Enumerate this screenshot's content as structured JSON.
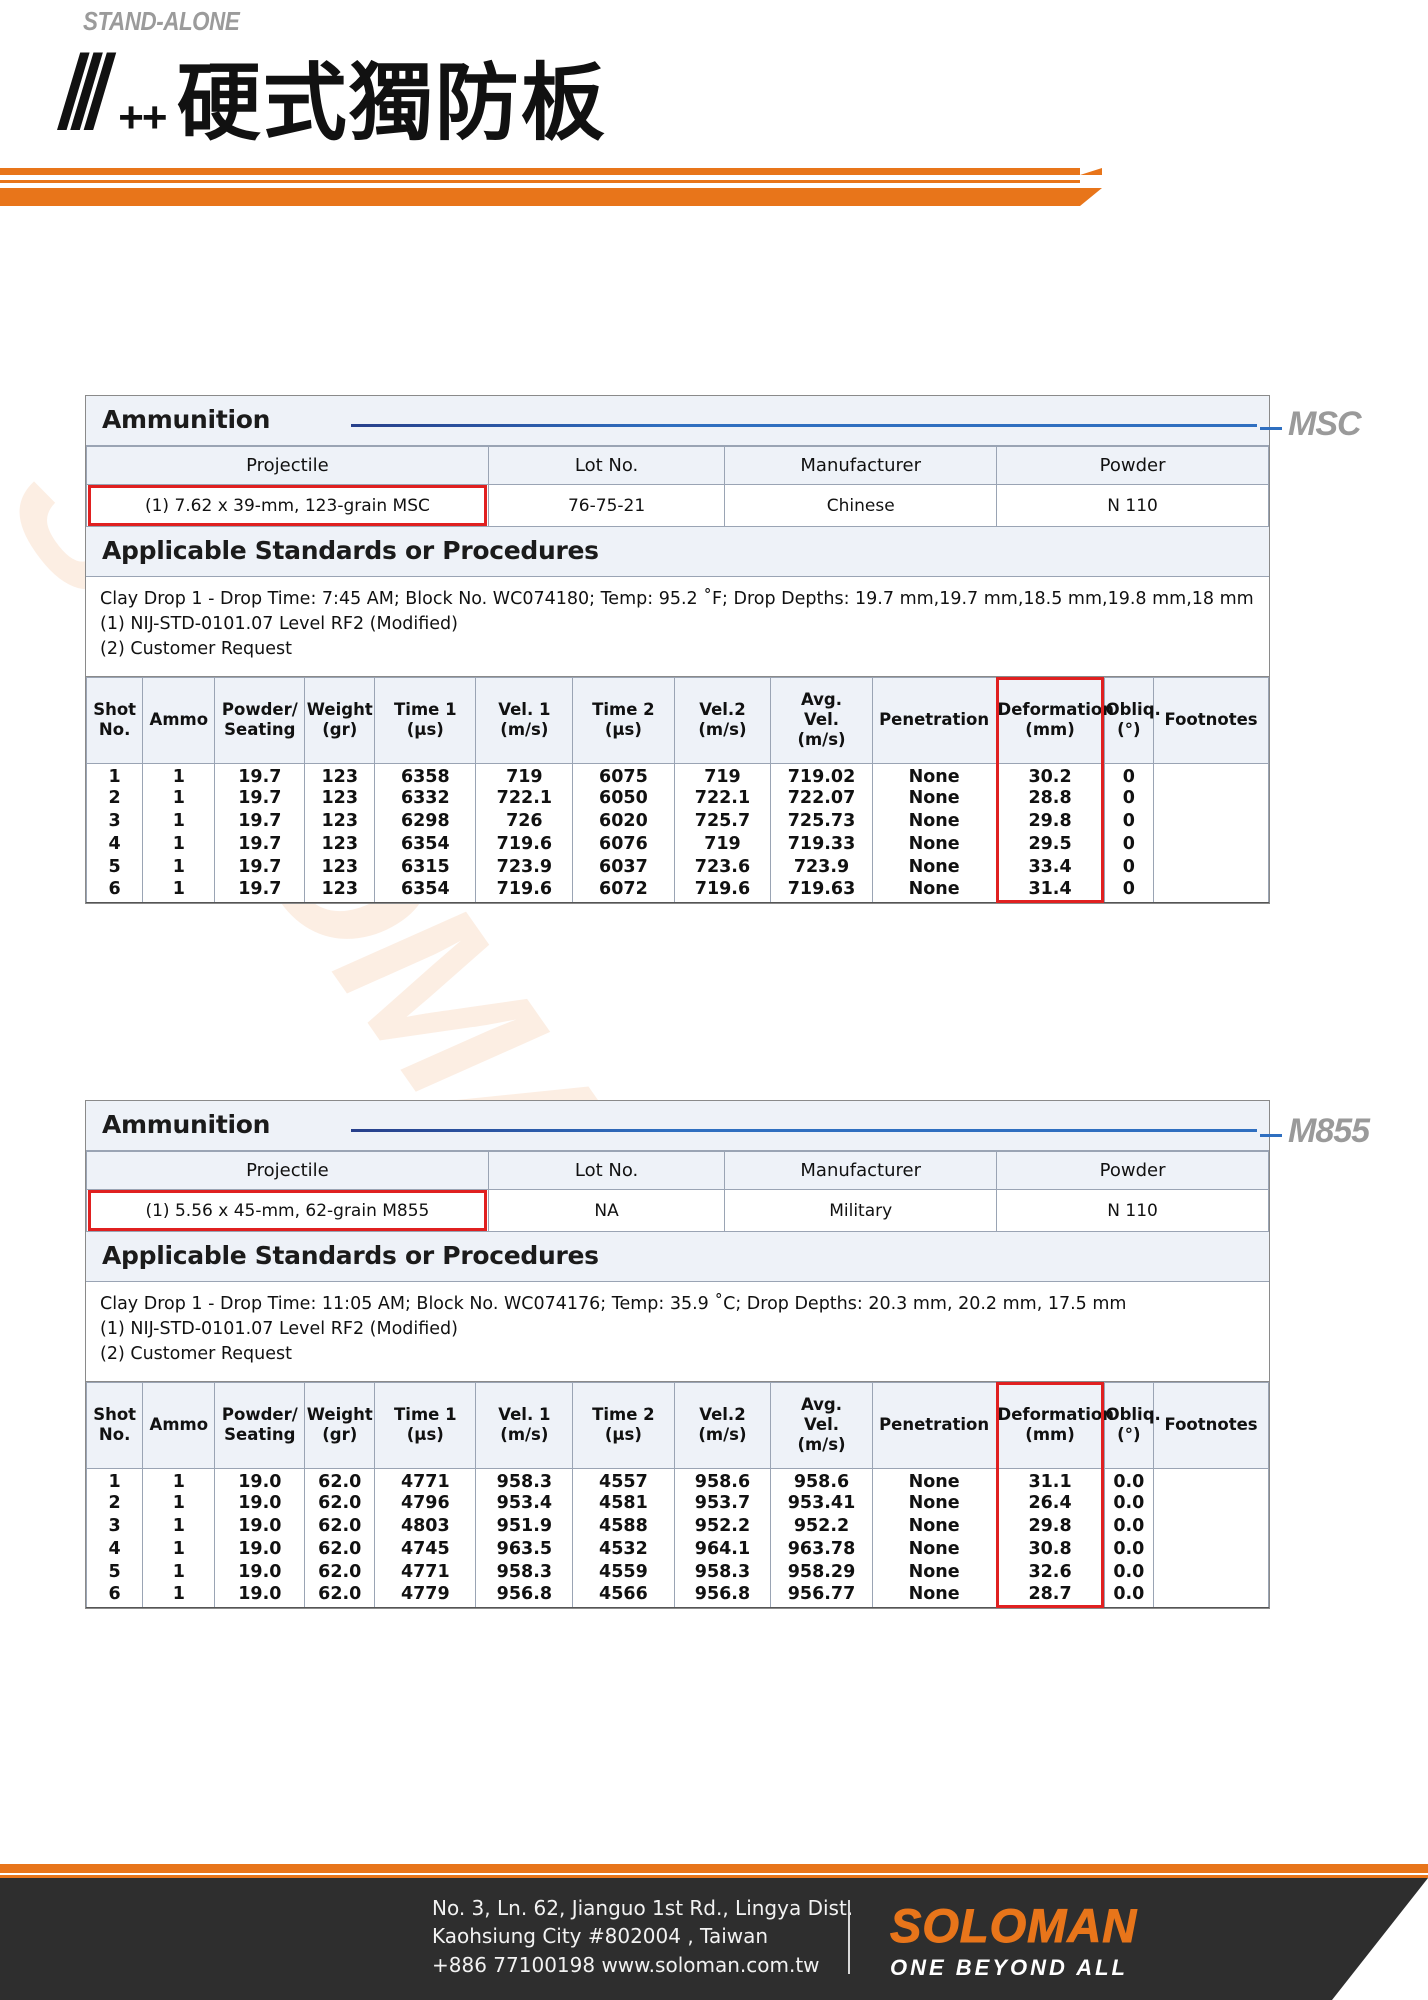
{
  "header": {
    "kicker": "STAND-ALONE",
    "mark_slashes": "///",
    "mark_plus": "++",
    "title_cjk": "硬式獨防板"
  },
  "watermark": {
    "text": "SOLOMAN"
  },
  "side_labels": {
    "msc": "MSC",
    "m855": "M855"
  },
  "reports": [
    {
      "id": "msc",
      "ammunition_band": "Ammunition",
      "ammo_headers": [
        "Projectile",
        "Lot No.",
        "Manufacturer",
        "Powder"
      ],
      "ammo_values": [
        "(1) 7.62 x 39-mm, 123-grain MSC",
        "76-75-21",
        "Chinese",
        "N 110"
      ],
      "standards_band": "Applicable Standards or Procedures",
      "standards_lines": [
        "Clay Drop 1 - Drop Time: 7:45 AM; Block No. WC074180; Temp: 95.2 ˚F; Drop Depths: 19.7 mm,19.7 mm,18.5 mm,19.8 mm,18 mm",
        "(1) NIJ-STD-0101.07 Level RF2 (Modified)",
        "(2) Customer Request"
      ],
      "shot_headers": [
        "Shot\nNo.",
        "Ammo",
        "Powder/\nSeating",
        "Weight\n(gr)",
        "Time 1\n(µs)",
        "Vel. 1\n(m/s)",
        "Time 2\n(µs)",
        "Vel.2\n(m/s)",
        "Avg.\nVel.\n(m/s)",
        "Penetration",
        "Deformation\n(mm)",
        "Obliq.\n(°)",
        "Footnotes"
      ],
      "shot_rows": [
        [
          "1",
          "1",
          "19.7",
          "123",
          "6358",
          "719",
          "6075",
          "719",
          "719.02",
          "None",
          "30.2",
          "0",
          ""
        ],
        [
          "2",
          "1",
          "19.7",
          "123",
          "6332",
          "722.1",
          "6050",
          "722.1",
          "722.07",
          "None",
          "28.8",
          "0",
          ""
        ],
        [
          "3",
          "1",
          "19.7",
          "123",
          "6298",
          "726",
          "6020",
          "725.7",
          "725.73",
          "None",
          "29.8",
          "0",
          ""
        ],
        [
          "4",
          "1",
          "19.7",
          "123",
          "6354",
          "719.6",
          "6076",
          "719",
          "719.33",
          "None",
          "29.5",
          "0",
          ""
        ],
        [
          "5",
          "1",
          "19.7",
          "123",
          "6315",
          "723.9",
          "6037",
          "723.6",
          "723.9",
          "None",
          "33.4",
          "0",
          ""
        ],
        [
          "6",
          "1",
          "19.7",
          "123",
          "6354",
          "719.6",
          "6072",
          "719.6",
          "719.63",
          "None",
          "31.4",
          "0",
          ""
        ]
      ]
    },
    {
      "id": "m855",
      "ammunition_band": "Ammunition",
      "ammo_headers": [
        "Projectile",
        "Lot No.",
        "Manufacturer",
        "Powder"
      ],
      "ammo_values": [
        "(1) 5.56 x 45-mm, 62-grain M855",
        "NA",
        "Military",
        "N 110"
      ],
      "standards_band": "Applicable Standards or Procedures",
      "standards_lines": [
        "Clay Drop 1 - Drop Time: 11:05 AM; Block No. WC074176; Temp: 35.9 ˚C; Drop Depths: 20.3 mm, 20.2 mm, 17.5 mm",
        "(1) NIJ-STD-0101.07 Level RF2 (Modified)",
        "(2) Customer Request"
      ],
      "shot_headers": [
        "Shot\nNo.",
        "Ammo",
        "Powder/\nSeating",
        "Weight\n(gr)",
        "Time 1\n(µs)",
        "Vel. 1\n(m/s)",
        "Time 2\n(µs)",
        "Vel.2\n(m/s)",
        "Avg.\nVel.\n(m/s)",
        "Penetration",
        "Deformation\n(mm)",
        "Obliq.\n(°)",
        "Footnotes"
      ],
      "shot_rows": [
        [
          "1",
          "1",
          "19.0",
          "62.0",
          "4771",
          "958.3",
          "4557",
          "958.6",
          "958.6",
          "None",
          "31.1",
          "0.0",
          ""
        ],
        [
          "2",
          "1",
          "19.0",
          "62.0",
          "4796",
          "953.4",
          "4581",
          "953.7",
          "953.41",
          "None",
          "26.4",
          "0.0",
          ""
        ],
        [
          "3",
          "1",
          "19.0",
          "62.0",
          "4803",
          "951.9",
          "4588",
          "952.2",
          "952.2",
          "None",
          "29.8",
          "0.0",
          ""
        ],
        [
          "4",
          "1",
          "19.0",
          "62.0",
          "4745",
          "963.5",
          "4532",
          "964.1",
          "963.78",
          "None",
          "30.8",
          "0.0",
          ""
        ],
        [
          "5",
          "1",
          "19.0",
          "62.0",
          "4771",
          "958.3",
          "4559",
          "958.3",
          "958.29",
          "None",
          "32.6",
          "0.0",
          ""
        ],
        [
          "6",
          "1",
          "19.0",
          "62.0",
          "4779",
          "956.8",
          "4566",
          "956.8",
          "956.77",
          "None",
          "28.7",
          "0.0",
          ""
        ]
      ]
    }
  ],
  "footer": {
    "address_line1": "No. 3, Ln. 62, Jianguo 1st Rd., Lingya Dist.",
    "address_line2": "Kaohsiung City #802004 , Taiwan",
    "address_line3": "+886 77100198      www.soloman.com.tw",
    "brand_name": "SOLOMAN",
    "brand_tagline": "ONE BEYOND ALL"
  },
  "colors": {
    "accent_orange": "#E8751A",
    "highlight_red": "#E02020",
    "band_blue": "#2f6fc0",
    "footer_dark": "#2E2E2E"
  }
}
